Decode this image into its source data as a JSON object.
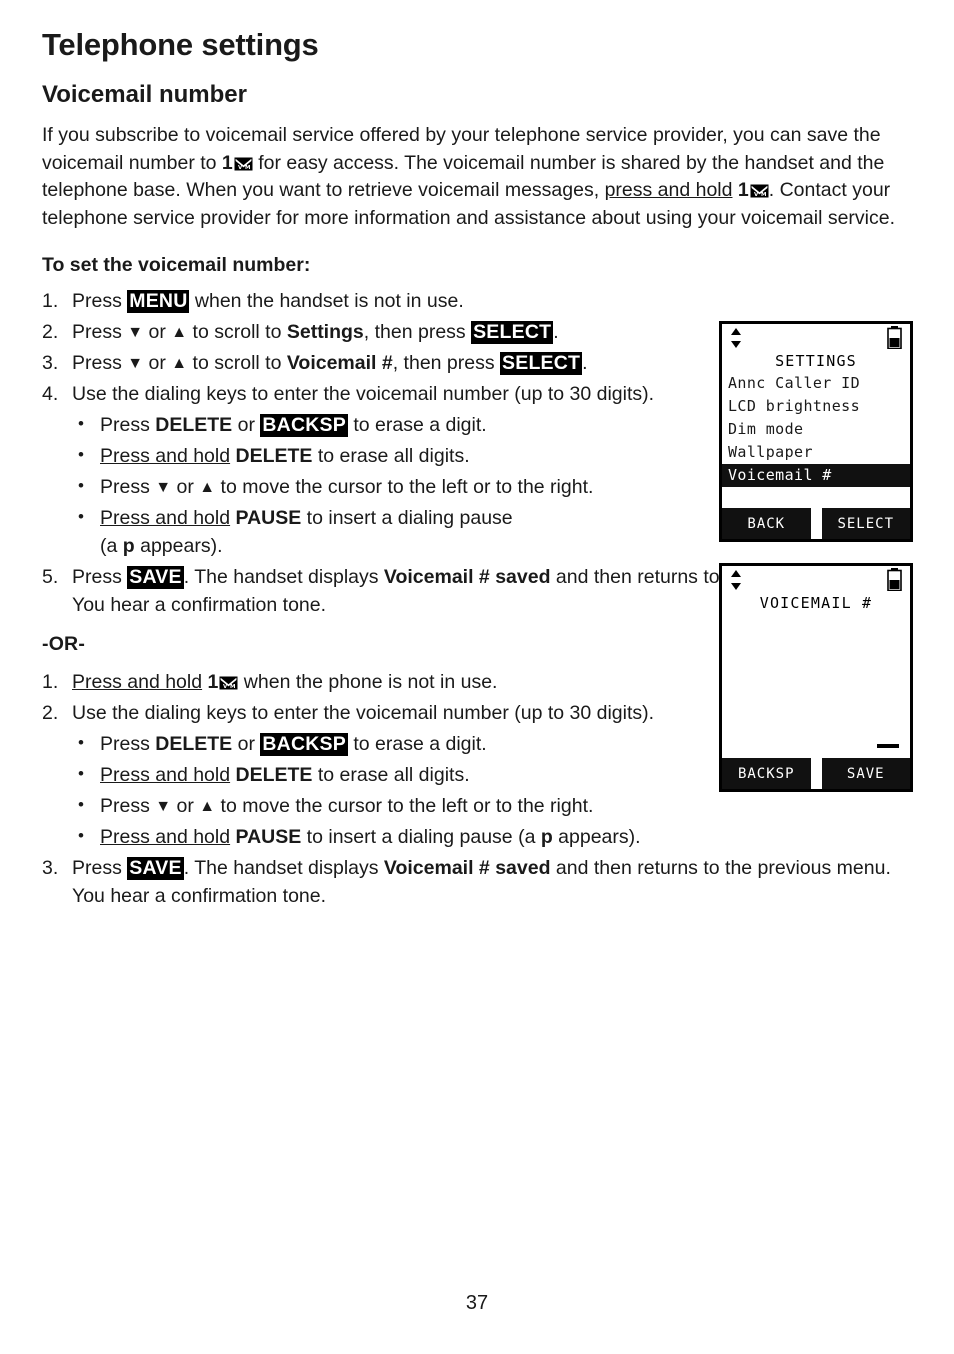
{
  "document": {
    "chapter_title": "Telephone settings",
    "section_title": "Voicemail number",
    "page_number": "37"
  },
  "intro": {
    "part1": "If you subscribe to voicemail service offered by your telephone service provider, you can save the voicemail number to ",
    "key1": "1",
    "part2": " for easy access. The voicemail number is shared by the handset and the telephone base. When you want to retrieve voicemail messages, ",
    "press_hold": "press and hold",
    "key2": "1",
    "part3": ". Contact your telephone service provider for more information and assistance about using your voicemail service."
  },
  "procedure": {
    "heading": "To set the voicemail number:",
    "step1": {
      "num": "1.",
      "pre": "Press ",
      "key": "MENU",
      "post": " when the handset is not in use."
    },
    "step2": {
      "num": "2.",
      "pre": "Press ",
      "down": "▼",
      "mid_or": " or ",
      "up": "▲",
      "mid": " to scroll to ",
      "target": "Settings",
      "mid2": ", then press ",
      "key": "SELECT",
      "post": "."
    },
    "step3": {
      "num": "3.",
      "pre": "Press ",
      "down": "▼",
      "mid_or": " or ",
      "up": "▲",
      "mid": " to scroll to ",
      "target": "Voicemail #",
      "mid2": ", then press ",
      "key": "SELECT",
      "post": "."
    },
    "step4": {
      "num": "4.",
      "text": "Use the dialing keys to enter the voicemail number (up to 30 digits).",
      "bullets": [
        {
          "pre": "Press ",
          "bold1": "DELETE",
          "mid": " or ",
          "key": "BACKSP",
          "post": " to erase a digit."
        },
        {
          "underline": "Press and hold",
          "bold1": "DELETE",
          "post": " to erase all digits."
        },
        {
          "pre": "Press ",
          "down": "▼",
          "mid_or": " or ",
          "up": "▲",
          "post": " to move the cursor to the left or to the right."
        },
        {
          "underline": "Press and hold",
          "bold1": "PAUSE",
          "post": " to insert a dialing pause",
          "post2_pre": "(a ",
          "post2_bold": "p",
          "post2_end": " appears)."
        }
      ]
    },
    "step5": {
      "num": "5.",
      "pre": "Press ",
      "key": "SAVE",
      "mid": ". The handset displays ",
      "bold": "Voicemail # saved",
      "post": " and then returns to the previous menu. You hear a confirmation tone."
    }
  },
  "alternate": {
    "or_label": "-OR-",
    "step1": {
      "num": "1.",
      "underline": "Press and hold",
      "key": "1",
      "post": " when the phone is not in use."
    },
    "step2": {
      "num": "2.",
      "text": "Use the dialing keys to enter the voicemail number (up to 30 digits).",
      "bullets": [
        {
          "pre": "Press ",
          "bold1": "DELETE",
          "mid": " or ",
          "key": "BACKSP",
          "post": " to erase a digit."
        },
        {
          "underline": "Press and hold",
          "bold1": "DELETE",
          "post": " to erase all digits."
        },
        {
          "pre": "Press ",
          "down": "▼",
          "mid_or": " or ",
          "up": "▲",
          "post": " to move the cursor to the left or to the right."
        },
        {
          "underline": "Press and hold",
          "bold1": "PAUSE",
          "post": " to insert a dialing pause (a ",
          "post2_bold": "p",
          "post2_end": " appears)."
        }
      ]
    },
    "step3": {
      "num": "3.",
      "pre": "Press ",
      "key": "SAVE",
      "mid": ". The handset displays ",
      "bold": "Voicemail # saved",
      "post": " and then returns to the previous menu. You hear a confirmation tone."
    }
  },
  "lcd_settings": {
    "title": "SETTINGS",
    "items": [
      "Annc Caller ID",
      "LCD brightness",
      "Dim mode",
      "Wallpaper"
    ],
    "selected_item": "Voicemail #",
    "softkey_left": "BACK",
    "softkey_right": "SELECT"
  },
  "lcd_voicemail": {
    "title": "VOICEMAIL #",
    "softkey_left": "BACKSP",
    "softkey_right": "SAVE"
  }
}
